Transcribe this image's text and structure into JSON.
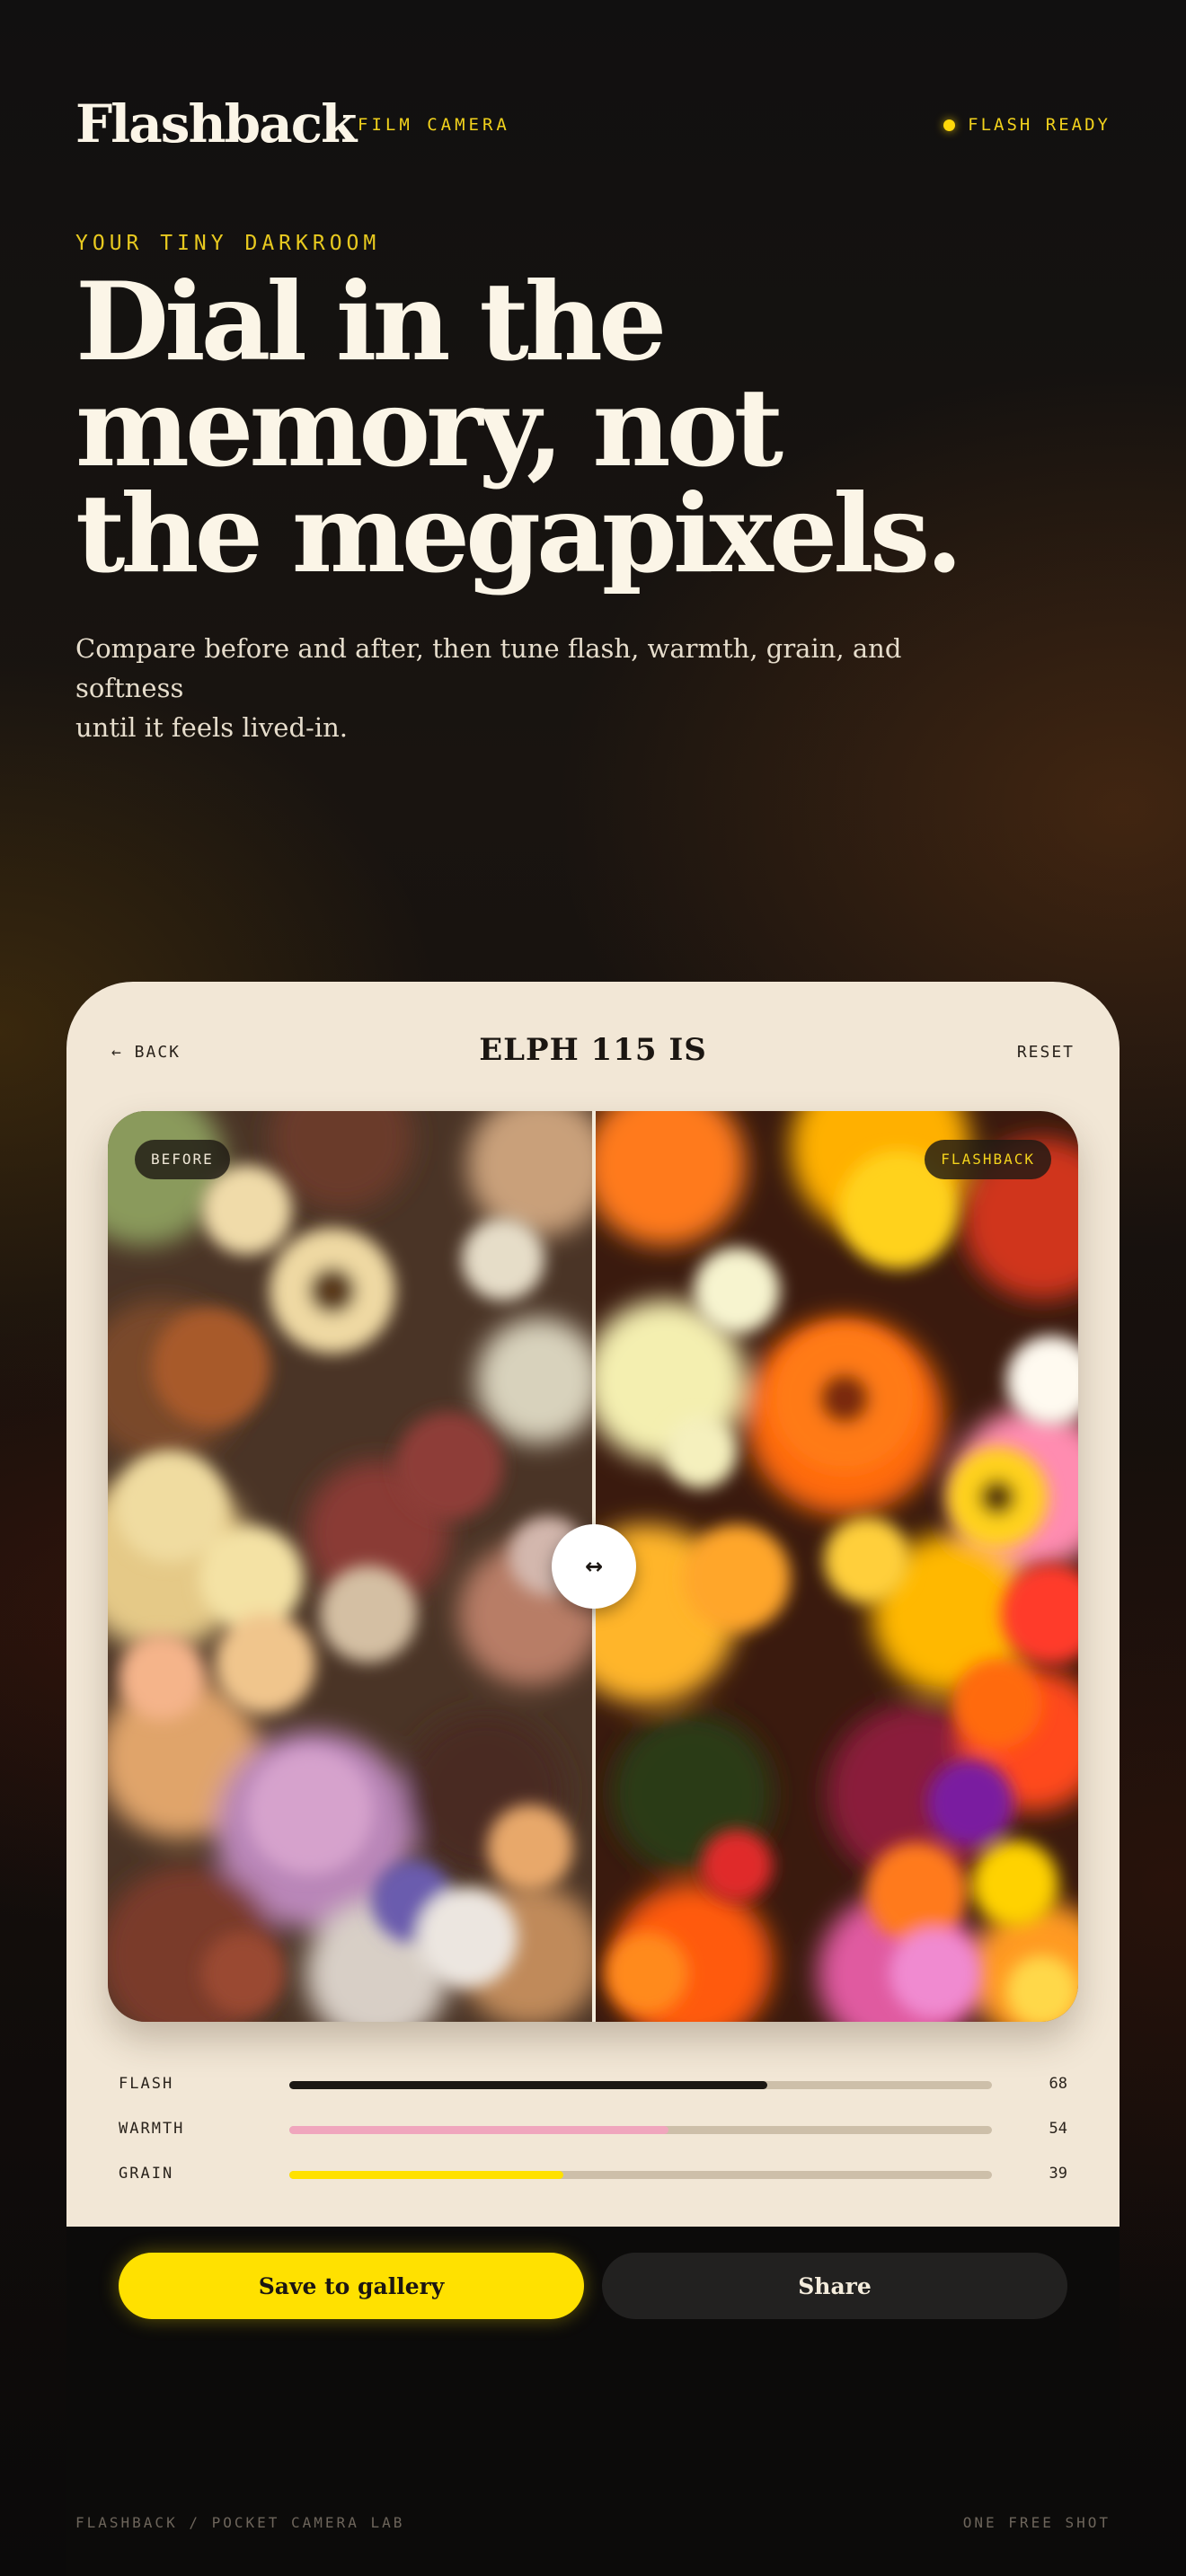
{
  "header": {
    "brand": "Flashback",
    "brand_tag": "FILM CAMERA",
    "status": "FLASH READY"
  },
  "hero": {
    "eyebrow": "YOUR TINY DARKROOM",
    "headline_lines": [
      "Dial in the",
      "memory, not",
      "the megapixels."
    ],
    "subhead_lines": [
      "Compare before and after, then tune flash, warmth, grain, and softness",
      "until it feels lived-in."
    ]
  },
  "editor": {
    "back_label": "← BACK",
    "title": "ELPH 115 IS",
    "reset_label": "RESET",
    "before_badge": "BEFORE",
    "after_badge": "FLASHBACK",
    "handle_glyph": "↔",
    "compare_split": 0.5,
    "sliders": [
      {
        "label": "FLASH",
        "value": "68",
        "fraction": 0.68,
        "color": "#1c1814"
      },
      {
        "label": "WARMTH",
        "value": "54",
        "fraction": 0.54,
        "color": "#f0a6bd"
      },
      {
        "label": "GRAIN",
        "value": "39",
        "fraction": 0.39,
        "color": "#ffe100"
      }
    ]
  },
  "actions": {
    "save_label": "Save to gallery",
    "share_label": "Share"
  },
  "footer": {
    "left": "FLASHBACK / POCKET CAMERA LAB",
    "right": "ONE FREE SHOT"
  }
}
